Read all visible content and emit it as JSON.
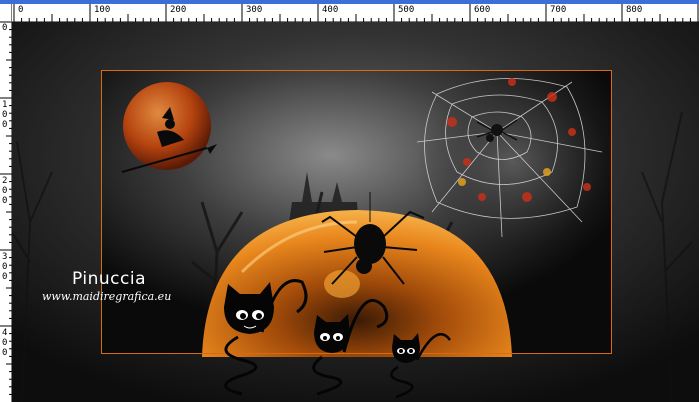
{
  "ruler": {
    "top_ticks": [
      "0",
      "100",
      "200",
      "300",
      "400",
      "500",
      "600",
      "700",
      "800"
    ],
    "left_ticks": [
      "0",
      "1 0 0",
      "2 0 0",
      "3 0 0",
      "4 0 0"
    ]
  },
  "signature": {
    "name": "Pinuccia",
    "url": "www.maidiregrafica.eu"
  },
  "colors": {
    "frame": "#d96a12",
    "moon": "#b5430f",
    "dome": "#e07a18",
    "ruler_bg": "#ffffff",
    "window_band": "#3a6fd8"
  }
}
